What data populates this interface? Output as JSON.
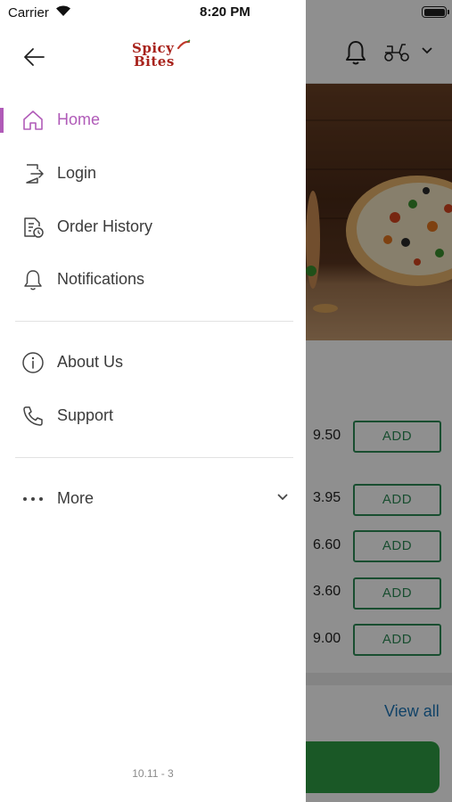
{
  "status_bar": {
    "carrier": "Carrier",
    "time": "8:20 PM"
  },
  "drawer": {
    "logo_line1": "Spicy",
    "logo_line2": "Bites",
    "menu": [
      {
        "label": "Home",
        "icon": "home-icon",
        "active": true
      },
      {
        "label": "Login",
        "icon": "login-icon",
        "active": false
      },
      {
        "label": "Order History",
        "icon": "order-history-icon",
        "active": false
      },
      {
        "label": "Notifications",
        "icon": "bell-icon",
        "active": false
      },
      {
        "label": "About Us",
        "icon": "info-icon",
        "active": false
      },
      {
        "label": "Support",
        "icon": "phone-icon",
        "active": false
      },
      {
        "label": "More",
        "icon": "more-dots-icon",
        "active": false
      }
    ],
    "version": "10.11 - 3"
  },
  "background": {
    "prices": [
      "9.50",
      "3.95",
      "6.60",
      "3.60",
      "9.00"
    ],
    "add_label": "ADD",
    "view_all": "View all"
  },
  "colors": {
    "accent": "#b05bb8",
    "add_green": "#2e8b57",
    "link_blue": "#1d76b8",
    "logo_red": "#a8231c"
  }
}
